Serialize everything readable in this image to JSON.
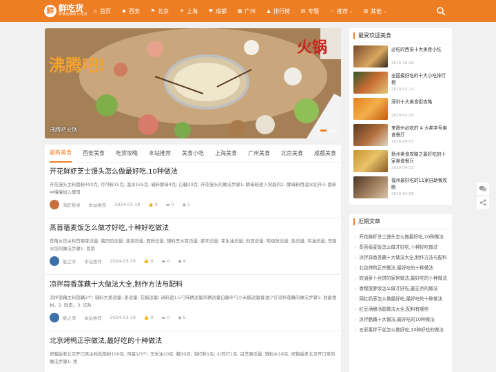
{
  "brand": {
    "badge": "鲜",
    "name": "鲜吃货",
    "slogan": "鲜食美食网·小吃点"
  },
  "nav": [
    {
      "icon": "⌂",
      "label": "首页",
      "caret": ""
    },
    {
      "icon": "◆",
      "label": "西安",
      "caret": ""
    },
    {
      "icon": "⚑",
      "label": "北京",
      "caret": ""
    },
    {
      "icon": "✈",
      "label": "上海",
      "caret": ""
    },
    {
      "icon": "♥",
      "label": "成都",
      "caret": ""
    },
    {
      "icon": "▦",
      "label": "广州",
      "caret": ""
    },
    {
      "icon": "▲",
      "label": "排行榜",
      "caret": ""
    },
    {
      "icon": "▤",
      "label": "专题",
      "caret": ""
    },
    {
      "icon": "☝",
      "label": "推荐",
      "caret": "⌄"
    },
    {
      "icon": "▥",
      "label": "其他",
      "caret": "⌄"
    }
  ],
  "hero": {
    "overlay_text": "沸腾吧!",
    "corner_text": "火锅",
    "caption": "沸腾吧火锅"
  },
  "tabs": [
    "最新美食",
    "西安美食",
    "吃货攻略",
    "本站推荐",
    "美食小吃",
    "上海美食",
    "广州美食",
    "北京美食",
    "成都美食"
  ],
  "articles": [
    {
      "title": "开花鲜虾芝士馒头怎么做最好吃,10种做法",
      "excerpt": "开花馒头主料面粉400克; 可可粉15克; 温水165克; 辅料酵母4克; 白糖20克; 开花馒头的做法步骤1: 酵母粉放入容器内2: 酵母粉用温水化开3: 面粉中慢慢加入酵母",
      "author": "海匠餐桌",
      "category": "本站推荐",
      "date": "2024-03-19",
      "likes": "0",
      "comments": "0",
      "views": "1"
    },
    {
      "title": "蒸苜蓿麦饭怎么做才好吃,十种好吃做法",
      "excerpt": "苜蓿水饺主料苜蓿芽适量; 猪肉馅适量; 韭菜适量; 面粉适量; 辅料黑木耳适量; 姜末适量; 花生油适量; 料酒适量; 味级鲜适量; 盐适量; 鸡油适量; 苜蓿水饺的做法步骤1: 苜菜",
      "author": "能之添",
      "category": "本站推荐",
      "date": "2024-03-19",
      "likes": "0",
      "comments": "0",
      "views": "4"
    },
    {
      "title": "凉拌蒜香莲藕十大做法大全,制作方法与配料",
      "excerpt": "凉拌莲藕主料莲藕2个; 辅料大葱适量; 姜适量; 花椒适量; 调料盐1.5勺味精适量鸡精适量白糖半勺小米醋适量香油少许凉拌莲藕的做法步骤1: 准备食材。2: 削皮。3: 切片",
      "author": "能之添",
      "category": "本站推荐",
      "date": "2024-03-19",
      "likes": "0",
      "comments": "0",
      "views": "5"
    },
    {
      "title": "北京烤鸭正宗做法,最好吃的十种做法",
      "excerpt": "烤箱版老北京开口笑主料低筋粉100克; 鸡蛋1/3个; 玉米油10克; 糖30克; 泡打粉1克; 小苏打1克; 白芝麻适量; 辅料水18克; 烤箱版老北京开口笑的做法步骤1: 用",
      "author": "",
      "category": "",
      "date": "",
      "likes": "",
      "comments": "",
      "views": ""
    }
  ],
  "popular": {
    "title": "最受欢迎美食",
    "items": [
      {
        "title": "必吃的西安十大美食小吃",
        "date": "2015-10-26"
      },
      {
        "title": "全国最好吃的十大小吃排行榜",
        "date": "2019-02-24"
      },
      {
        "title": "深圳十大美食街攻略",
        "date": "2019-03-29"
      },
      {
        "title": "来扬州必吃的 4 大老字号美食餐厅",
        "date": "2018-09-07"
      },
      {
        "title": "扬州美食攻略之最好吃的十家美食餐厅",
        "date": "2019-04-11"
      },
      {
        "title": "福州最好吃的11家自助餐攻略",
        "date": "2019-04-08"
      }
    ]
  },
  "recent": {
    "title": "近期文章",
    "items": [
      "开花鲜虾芝士馒头怎么做最好吃,10种做法",
      "蒸苜蓿麦饭怎么做才好吃,十种好吃做法",
      "凉拌蒜香莲藕十大做法大全,制作方法与配料",
      "北京烤鸭正宗做法,最好吃的十种做法",
      "姣油萝卜丝饼的家常做法,最好吃的十种做法",
      "香糯菠萝饭怎么做才好吃,最正宗的做法",
      "网红奶枣怎么做最好吃,最好吃的十种做法",
      "红豆酒酿汤圆做法大全,配料有哪些",
      "凉拌脆藕十大做法,最好吃的10种做法",
      "五彩素拌干丝怎么做好吃,10种好吃的做法"
    ]
  },
  "colors": {
    "accent": "#ee7e24",
    "page_bg": "#f1f1f1"
  }
}
